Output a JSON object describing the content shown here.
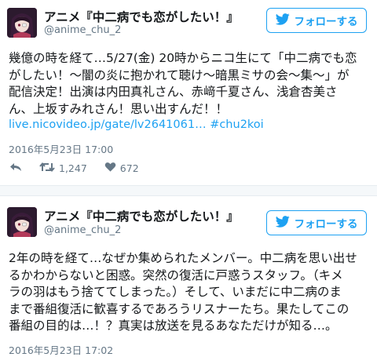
{
  "tweets": [
    {
      "display_name": "アニメ『中二病でも恋がしたい！』",
      "handle": "@anime_chu_2",
      "follow_label": "フォローする",
      "text": "幾億の時を経て…5/27(金) 20時からニコ生にて「中二病でも恋\nがしたい！～闇の炎に抱かれて聴け～暗黒ミサの会～集～」が\n配信決定！出演は内田真礼さん、赤﨑千夏さん、浅倉杏美さ\nん、上坂すみれさん！思い出すんだ！！",
      "link": "live.nicovideo.jp/gate/lv2641061…",
      "hashtag": "#chu2koi",
      "timestamp": "2016年5月23日  17:00",
      "retweets": "1,247",
      "likes": "672"
    },
    {
      "display_name": "アニメ『中二病でも恋がしたい！』",
      "handle": "@anime_chu_2",
      "follow_label": "フォローする",
      "text": "2年の時を経て…なぜか集められたメンバー。中二病を思い出せ\nるかわからないと困惑。突然の復活に戸惑うスタッフ。（キメ\nラの羽はもう捨ててしまった。）そして、いまだに中二病のま\nまで番組復活に歓喜するであろうリスナーたち。果たしてこの\n番組の目的は…！？真実は放送を見るあなただけが知る…。",
      "timestamp": "2016年5月23日  17:02"
    }
  ],
  "colors": {
    "accent": "#1da1f2",
    "secondary_text": "#657786",
    "separator": "#f5f8fa"
  },
  "icons": [
    "avatar",
    "twitter-bird-icon",
    "reply-icon",
    "retweet-icon",
    "like-icon"
  ]
}
